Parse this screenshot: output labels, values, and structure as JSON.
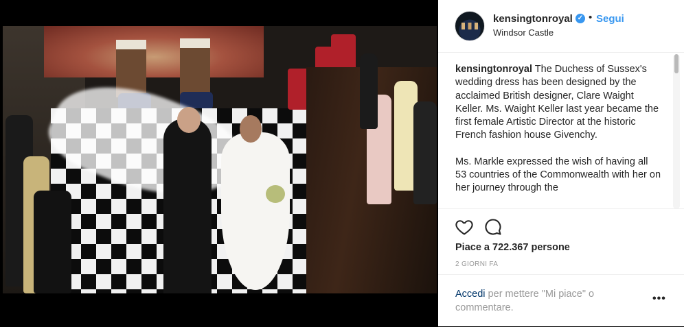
{
  "post": {
    "username": "kensingtonroyal",
    "follow_label": "Segui",
    "separator": "•",
    "location": "Windsor Castle",
    "caption_paragraph_1_rest": " The Duchess of Sussex's wedding dress has been designed by the acclaimed British designer, Clare Waight Keller. Ms. Waight Keller last year became the first female Artistic Director at the historic French fashion house Givenchy.",
    "caption_paragraph_2": "Ms. Markle expressed the wish of having all 53 countries of the Commonwealth with her on her journey through the",
    "likes_text": "Piace a 722.367 persone",
    "time_ago": "2 GIORNI FA",
    "login_link": "Accedi",
    "login_rest": " per mettere \"Mi piace\" o commentare.",
    "more_label": "•••"
  },
  "icons": {
    "verified": "verified-badge-icon",
    "like": "heart-icon",
    "comment": "comment-bubble-icon",
    "more": "more-options-icon"
  },
  "colors": {
    "link_blue": "#3897f0",
    "text": "#262626",
    "muted": "#999999",
    "login_link": "#003569"
  }
}
